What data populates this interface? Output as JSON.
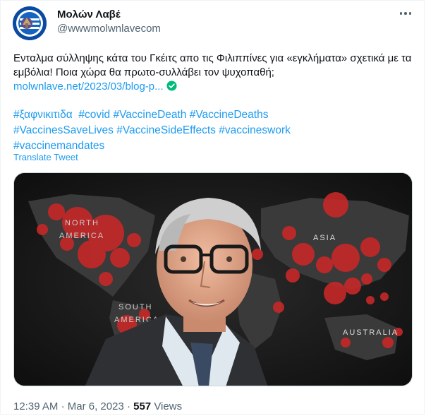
{
  "account": {
    "display_name": "Μολών Λαβέ",
    "handle": "@wwwmolwnlavecom"
  },
  "tweet": {
    "text": "Ενταλμα σύλληψης κάτα του Γκέιτς απο τις Φιλιππίνες για «εγκλήματα» σχετικά με τα εμβόλια! Ποια χώρα θα πρωτο-συλλάβει τον ψυχοπαθή;",
    "link_text": "molwnlave.net/2023/03/blog-p...",
    "hashtags": [
      "#ξαφνικιτιδα",
      "#covid",
      "#VaccineDeath",
      "#VaccineDeaths",
      "#VaccinesSaveLives",
      "#VaccineSideEffects",
      "#vaccineswork",
      "#vaccinemandates"
    ],
    "translate_label": "Translate Tweet"
  },
  "media": {
    "map_labels": {
      "north_america": "NORTH AMERICA",
      "south_america": "SOUTH AMERICA",
      "asia": "ASIA",
      "australia": "AUSTRALIA"
    }
  },
  "meta": {
    "time": "12:39 AM",
    "separator": "·",
    "date": "Mar 6, 2023",
    "views_count": "557",
    "views_label": "Views"
  },
  "icons": {
    "more": "more-icon",
    "verified": "verified-check-icon"
  },
  "colors": {
    "link": "#1d9bf0",
    "secondary_text": "#536471",
    "verified": "#00ba7c",
    "map_hotspot": "#d32f2f"
  }
}
